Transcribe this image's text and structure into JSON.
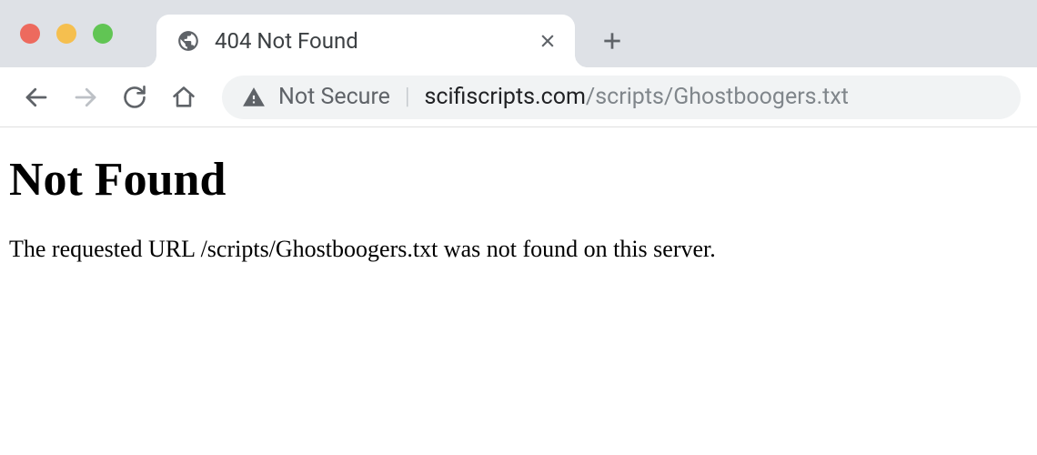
{
  "window": {
    "tab": {
      "title": "404 Not Found"
    }
  },
  "toolbar": {
    "security_label": "Not Secure",
    "url_host": "scifiscripts.com",
    "url_path": "/scripts/Ghostboogers.txt"
  },
  "page": {
    "heading": "Not Found",
    "message": "The requested URL /scripts/Ghostboogers.txt was not found on this server."
  }
}
